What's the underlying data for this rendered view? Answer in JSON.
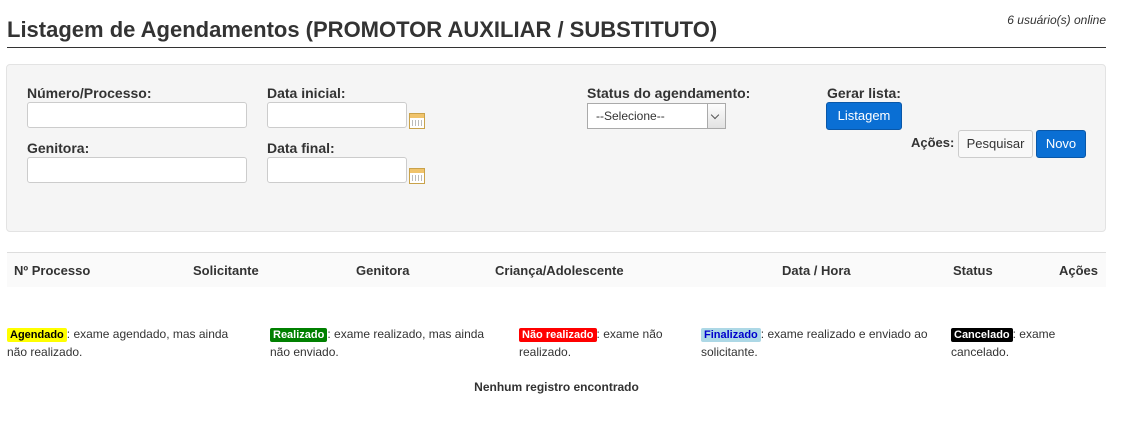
{
  "header": {
    "title": "Listagem de Agendamentos (PROMOTOR AUXILIAR / SUBSTITUTO)",
    "online": "6 usuário(s) online"
  },
  "filters": {
    "numero_label": "Número/Processo:",
    "numero_value": "",
    "data_inicial_label": "Data inicial:",
    "data_inicial_value": "",
    "genitora_label": "Genitora:",
    "genitora_value": "",
    "data_final_label": "Data final:",
    "data_final_value": "",
    "status_label": "Status do agendamento:",
    "status_selected": "--Selecione--",
    "gerar_label": "Gerar lista:",
    "listagem_button": "Listagem",
    "acoes_label": "Ações:",
    "pesquisar_button": "Pesquisar",
    "novo_button": "Novo"
  },
  "table": {
    "columns": [
      "Nº Processo",
      "Solicitante",
      "Genitora",
      "Criança/Adolescente",
      "Data / Hora",
      "Status",
      "Ações"
    ]
  },
  "legend": [
    {
      "badge": "Agendado",
      "bg": "#ffff00",
      "fg": "#000000",
      "text1": ": exame agendado, mas ainda",
      "text2": "não realizado."
    },
    {
      "badge": "Realizado",
      "bg": "#008000",
      "fg": "#ffffff",
      "text1": ": exame realizado, mas ainda",
      "text2": "não enviado."
    },
    {
      "badge": "Não realizado",
      "bg": "#ff0000",
      "fg": "#ffffff",
      "text1": ": exame não",
      "text2": "realizado."
    },
    {
      "badge": "Finalizado",
      "bg": "#add8e6",
      "fg": "#0000cc",
      "text1": ": exame realizado e enviado ao",
      "text2": "solicitante."
    },
    {
      "badge": "Cancelado",
      "bg": "#000000",
      "fg": "#ffffff",
      "text1": ": exame",
      "text2": "cancelado."
    }
  ],
  "empty_message": "Nenhum registro encontrado"
}
